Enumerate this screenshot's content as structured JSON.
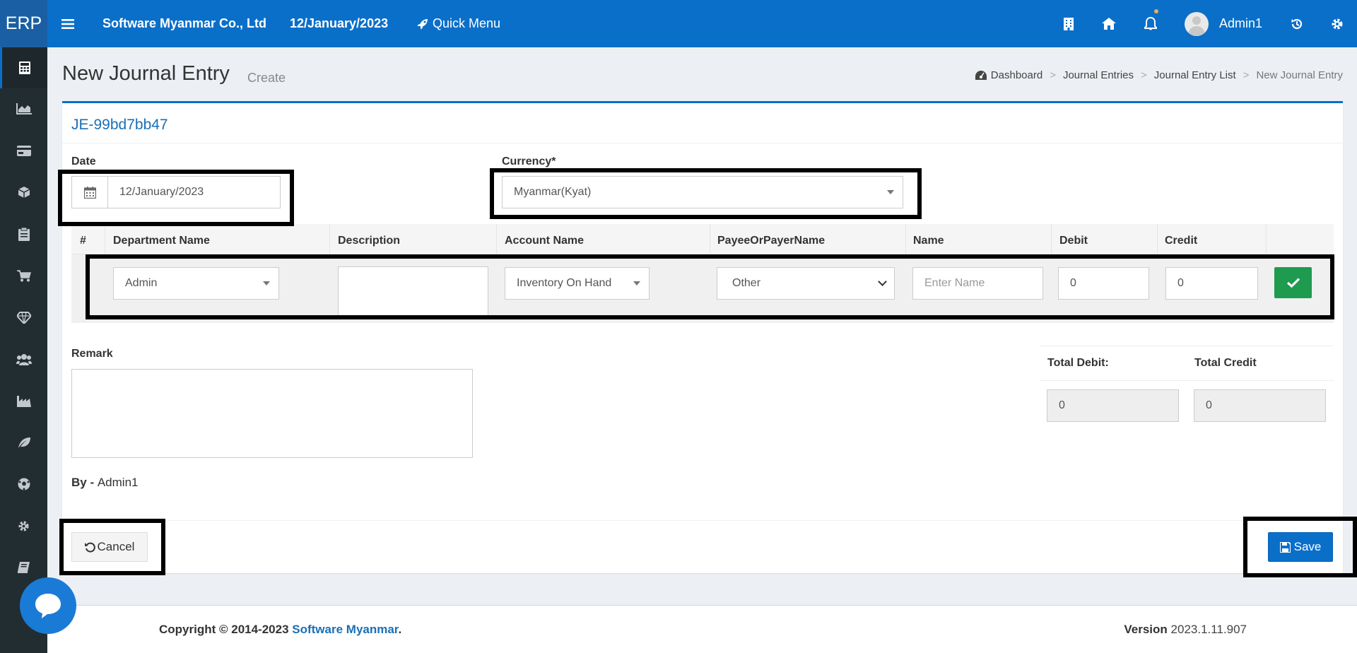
{
  "topbar": {
    "brand": "ERP",
    "company": "Software Myanmar Co., Ltd",
    "date": "12/January/2023",
    "quick_menu": "Quick Menu",
    "user": "Admin1"
  },
  "sidebar": {
    "items": [
      "calculator-icon",
      "area-chart-icon",
      "credit-card-icon",
      "cube-icon",
      "clipboard-icon",
      "cart-icon",
      "diamond-icon",
      "users-icon",
      "industry-icon",
      "leaf-icon",
      "soccer-ball-icon",
      "gear-icon",
      "book-icon",
      "chat-icon"
    ]
  },
  "header": {
    "title": "New Journal Entry",
    "subtitle": "Create",
    "breadcrumb": [
      "Dashboard",
      "Journal Entries",
      "Journal Entry List",
      "New Journal Entry"
    ]
  },
  "form": {
    "code": "JE-99bd7bb47",
    "date_label": "Date",
    "date_value": "12/January/2023",
    "currency_label": "Currency*",
    "currency_value": "Myanmar(Kyat)",
    "remark_label": "Remark",
    "by_label": "By - ",
    "by_value": "Admin1"
  },
  "table": {
    "headers": [
      "#",
      "Department Name",
      "Description",
      "Account Name",
      "PayeeOrPayerName",
      "Name",
      "Debit",
      "Credit"
    ],
    "row": {
      "department": "Admin",
      "description": "",
      "account": "Inventory On Hand",
      "payee": "Other",
      "name_placeholder": "Enter Name",
      "debit": "0",
      "credit": "0"
    }
  },
  "totals": {
    "debit_label": "Total Debit:",
    "credit_label": "Total Credit",
    "debit_value": "0",
    "credit_value": "0"
  },
  "actions": {
    "cancel": "Cancel",
    "save": "Save"
  },
  "footer": {
    "copyright_prefix": "Copyright © 2014-2023 ",
    "copyright_link": "Software Myanmar",
    "copyright_suffix": ".",
    "version_label": "Version",
    "version_value": "2023.1.11.907"
  },
  "colors": {
    "primary": "#0a6fc9",
    "sidebar": "#222d32",
    "success": "#1e9b4f"
  }
}
